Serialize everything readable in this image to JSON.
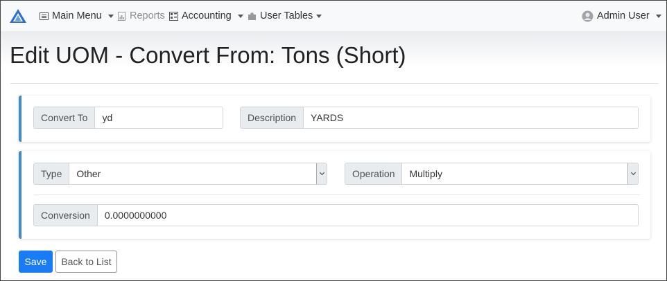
{
  "navbar": {
    "main_menu": "Main Menu",
    "reports": "Reports",
    "accounting": "Accounting",
    "user_tables": "User Tables",
    "user": "Admin User"
  },
  "page": {
    "title": "Edit UOM - Convert From: Tons (Short)"
  },
  "form": {
    "convert_to_label": "Convert To",
    "convert_to_value": "yd",
    "description_label": "Description",
    "description_value": "YARDS",
    "type_label": "Type",
    "type_value": "Other",
    "operation_label": "Operation",
    "operation_value": "Multiply",
    "conversion_label": "Conversion",
    "conversion_value": "0.0000000000"
  },
  "buttons": {
    "save": "Save",
    "back": "Back to List"
  },
  "colors": {
    "accent": "#3d8bd4",
    "primary_button": "#1a7cf5"
  }
}
